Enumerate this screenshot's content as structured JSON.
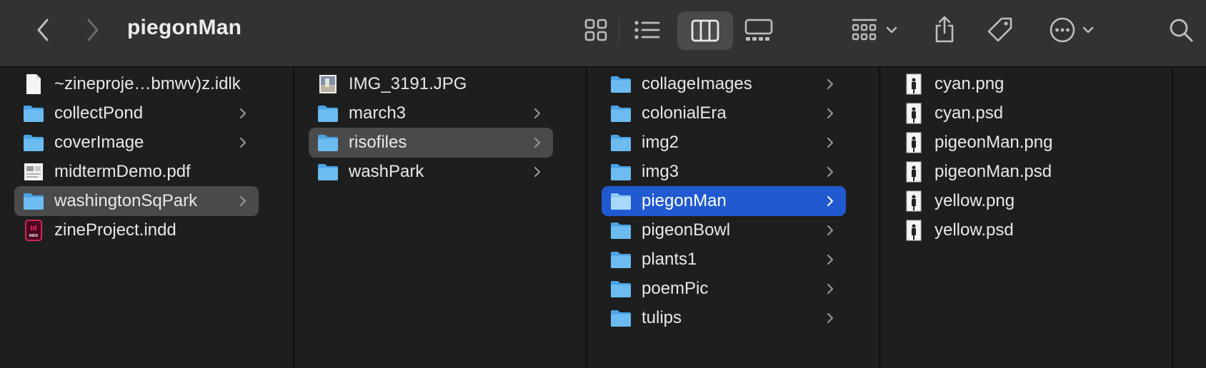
{
  "window": {
    "title": "piegonMan"
  },
  "toolbar": {
    "back_icon": "chevron-left-icon",
    "forward_icon": "chevron-right-icon",
    "view_buttons": [
      "icon-view",
      "list-view",
      "column-view",
      "gallery-view"
    ],
    "active_view": "column-view",
    "actions": [
      "group-menu",
      "share",
      "tags",
      "more-menu",
      "search"
    ]
  },
  "colors": {
    "selection_blue": "#2159d0",
    "selection_gray": "#4a4a4a",
    "folder_blue": "#5fb4ef"
  },
  "columns": [
    {
      "items": [
        {
          "name": "~zineproje…bmwv)z.idlk",
          "type": "doc",
          "folder": false
        },
        {
          "name": "collectPond",
          "type": "folder",
          "folder": true
        },
        {
          "name": "coverImage",
          "type": "folder",
          "folder": true
        },
        {
          "name": "midtermDemo.pdf",
          "type": "pdf",
          "folder": false
        },
        {
          "name": "washingtonSqPark",
          "type": "folder",
          "folder": true,
          "selected": "gray"
        },
        {
          "name": "zineProject.indd",
          "type": "indd",
          "folder": false
        }
      ]
    },
    {
      "items": [
        {
          "name": "IMG_3191.JPG",
          "type": "photo",
          "folder": false
        },
        {
          "name": "march3",
          "type": "folder",
          "folder": true
        },
        {
          "name": "risofiles",
          "type": "folder",
          "folder": true,
          "selected": "gray"
        },
        {
          "name": "washPark",
          "type": "folder",
          "folder": true
        }
      ]
    },
    {
      "items": [
        {
          "name": "collageImages",
          "type": "folder",
          "folder": true
        },
        {
          "name": "colonialEra",
          "type": "folder",
          "folder": true
        },
        {
          "name": "img2",
          "type": "folder",
          "folder": true
        },
        {
          "name": "img3",
          "type": "folder",
          "folder": true
        },
        {
          "name": "piegonMan",
          "type": "folder",
          "folder": true,
          "selected": "blue"
        },
        {
          "name": "pigeonBowl",
          "type": "folder",
          "folder": true
        },
        {
          "name": "plants1",
          "type": "folder",
          "folder": true
        },
        {
          "name": "poemPic",
          "type": "folder",
          "folder": true
        },
        {
          "name": "tulips",
          "type": "folder",
          "folder": true
        }
      ]
    },
    {
      "items": [
        {
          "name": "cyan.png",
          "type": "image",
          "folder": false
        },
        {
          "name": "cyan.psd",
          "type": "image",
          "folder": false
        },
        {
          "name": "pigeonMan.png",
          "type": "image",
          "folder": false
        },
        {
          "name": "pigeonMan.psd",
          "type": "image",
          "folder": false
        },
        {
          "name": "yellow.png",
          "type": "image",
          "folder": false
        },
        {
          "name": "yellow.psd",
          "type": "image",
          "folder": false
        }
      ]
    },
    {
      "items": []
    }
  ]
}
